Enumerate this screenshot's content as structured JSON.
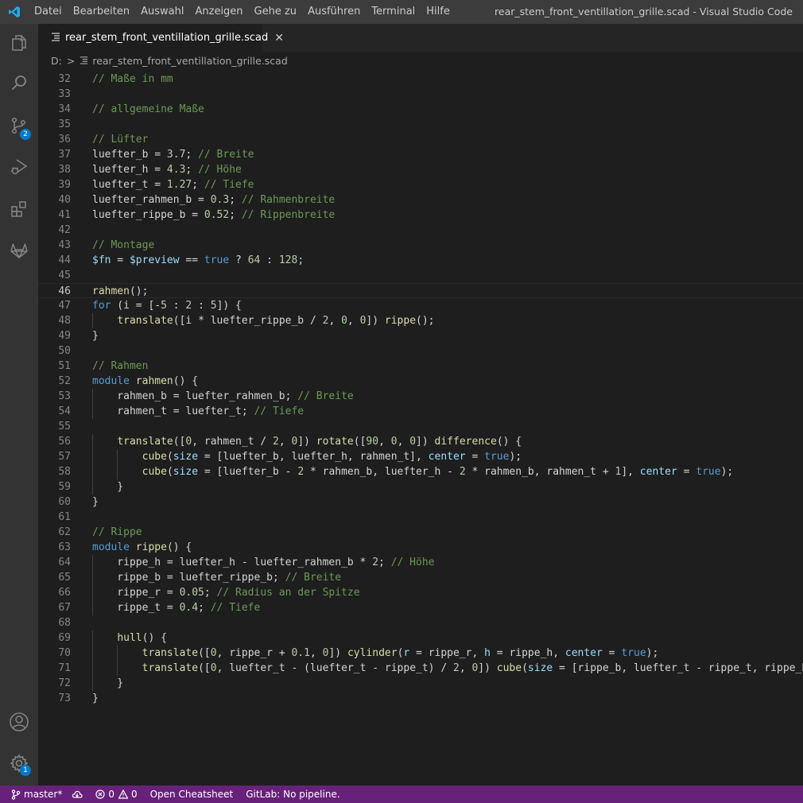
{
  "window": {
    "title": "rear_stem_front_ventillation_grille.scad - Visual Studio Code"
  },
  "menu": [
    "Datei",
    "Bearbeiten",
    "Auswahl",
    "Anzeigen",
    "Gehe zu",
    "Ausführen",
    "Terminal",
    "Hilfe"
  ],
  "activity_bar": {
    "icons": [
      "explorer-icon",
      "search-icon",
      "source-control-icon",
      "run-debug-icon",
      "extensions-icon",
      "gitlab-icon",
      "account-icon",
      "settings-gear-icon"
    ],
    "source_control_badge": "2",
    "settings_badge": "1"
  },
  "tab": {
    "label": "rear_stem_front_ventillation_grille.scad",
    "close_glyph": "✕"
  },
  "breadcrumb": {
    "drive": "D:",
    "separator": ">",
    "file": "rear_stem_front_ventillation_grille.scad"
  },
  "editor": {
    "active_line": 46,
    "lines": [
      {
        "n": "32",
        "tokens": [
          [
            "c",
            "// Maße in mm"
          ]
        ]
      },
      {
        "n": "33",
        "tokens": []
      },
      {
        "n": "34",
        "tokens": [
          [
            "c",
            "// allgemeine Maße"
          ]
        ]
      },
      {
        "n": "35",
        "tokens": []
      },
      {
        "n": "36",
        "tokens": [
          [
            "c",
            "// Lüfter"
          ]
        ]
      },
      {
        "n": "37",
        "tokens": [
          [
            "p",
            "luefter_b = "
          ],
          [
            "n",
            "3.7"
          ],
          [
            "p",
            "; "
          ],
          [
            "c",
            "// Breite"
          ]
        ]
      },
      {
        "n": "38",
        "tokens": [
          [
            "p",
            "luefter_h = "
          ],
          [
            "n",
            "4.3"
          ],
          [
            "p",
            "; "
          ],
          [
            "c",
            "// Höhe"
          ]
        ]
      },
      {
        "n": "39",
        "tokens": [
          [
            "p",
            "luefter_t = "
          ],
          [
            "n",
            "1.27"
          ],
          [
            "p",
            "; "
          ],
          [
            "c",
            "// Tiefe"
          ]
        ]
      },
      {
        "n": "40",
        "tokens": [
          [
            "p",
            "luefter_rahmen_b = "
          ],
          [
            "n",
            "0.3"
          ],
          [
            "p",
            "; "
          ],
          [
            "c",
            "// Rahmenbreite"
          ]
        ]
      },
      {
        "n": "41",
        "tokens": [
          [
            "p",
            "luefter_rippe_b = "
          ],
          [
            "n",
            "0.52"
          ],
          [
            "p",
            "; "
          ],
          [
            "c",
            "// Rippenbreite"
          ]
        ]
      },
      {
        "n": "42",
        "tokens": []
      },
      {
        "n": "43",
        "tokens": [
          [
            "c",
            "// Montage"
          ]
        ]
      },
      {
        "n": "44",
        "tokens": [
          [
            "v",
            "$fn"
          ],
          [
            "p",
            " = "
          ],
          [
            "v",
            "$preview"
          ],
          [
            "p",
            " == "
          ],
          [
            "k",
            "true"
          ],
          [
            "p",
            " ? "
          ],
          [
            "n",
            "64"
          ],
          [
            "p",
            " : "
          ],
          [
            "n",
            "128"
          ],
          [
            "p",
            ";"
          ]
        ]
      },
      {
        "n": "45",
        "tokens": []
      },
      {
        "n": "46",
        "tokens": [
          [
            "f",
            "rahmen"
          ],
          [
            "p",
            "();"
          ]
        ]
      },
      {
        "n": "47",
        "tokens": [
          [
            "k",
            "for"
          ],
          [
            "p",
            " (i = [-"
          ],
          [
            "n",
            "5"
          ],
          [
            "p",
            " : "
          ],
          [
            "n",
            "2"
          ],
          [
            "p",
            " : "
          ],
          [
            "n",
            "5"
          ],
          [
            "p",
            "]) {"
          ]
        ]
      },
      {
        "n": "48",
        "tokens": [
          [
            "p",
            "    "
          ],
          [
            "f",
            "translate"
          ],
          [
            "p",
            "([i * luefter_rippe_b / "
          ],
          [
            "n",
            "2"
          ],
          [
            "p",
            ", "
          ],
          [
            "n",
            "0"
          ],
          [
            "p",
            ", "
          ],
          [
            "n",
            "0"
          ],
          [
            "p",
            "]) "
          ],
          [
            "f",
            "rippe"
          ],
          [
            "p",
            "();"
          ]
        ]
      },
      {
        "n": "49",
        "tokens": [
          [
            "p",
            "}"
          ]
        ]
      },
      {
        "n": "50",
        "tokens": []
      },
      {
        "n": "51",
        "tokens": [
          [
            "c",
            "// Rahmen"
          ]
        ]
      },
      {
        "n": "52",
        "tokens": [
          [
            "k",
            "module"
          ],
          [
            "p",
            " "
          ],
          [
            "f",
            "rahmen"
          ],
          [
            "p",
            "() {"
          ]
        ]
      },
      {
        "n": "53",
        "tokens": [
          [
            "p",
            "    rahmen_b = luefter_rahmen_b; "
          ],
          [
            "c",
            "// Breite"
          ]
        ]
      },
      {
        "n": "54",
        "tokens": [
          [
            "p",
            "    rahmen_t = luefter_t; "
          ],
          [
            "c",
            "// Tiefe"
          ]
        ]
      },
      {
        "n": "55",
        "tokens": []
      },
      {
        "n": "56",
        "tokens": [
          [
            "p",
            "    "
          ],
          [
            "f",
            "translate"
          ],
          [
            "p",
            "(["
          ],
          [
            "n",
            "0"
          ],
          [
            "p",
            ", rahmen_t / "
          ],
          [
            "n",
            "2"
          ],
          [
            "p",
            ", "
          ],
          [
            "n",
            "0"
          ],
          [
            "p",
            "]) "
          ],
          [
            "f",
            "rotate"
          ],
          [
            "p",
            "(["
          ],
          [
            "n",
            "90"
          ],
          [
            "p",
            ", "
          ],
          [
            "n",
            "0"
          ],
          [
            "p",
            ", "
          ],
          [
            "n",
            "0"
          ],
          [
            "p",
            "]) "
          ],
          [
            "f",
            "difference"
          ],
          [
            "p",
            "() {"
          ]
        ]
      },
      {
        "n": "57",
        "tokens": [
          [
            "p",
            "        "
          ],
          [
            "f",
            "cube"
          ],
          [
            "p",
            "("
          ],
          [
            "v",
            "size"
          ],
          [
            "p",
            " = [luefter_b, luefter_h, rahmen_t], "
          ],
          [
            "v",
            "center"
          ],
          [
            "p",
            " = "
          ],
          [
            "k",
            "true"
          ],
          [
            "p",
            ");"
          ]
        ]
      },
      {
        "n": "58",
        "tokens": [
          [
            "p",
            "        "
          ],
          [
            "f",
            "cube"
          ],
          [
            "p",
            "("
          ],
          [
            "v",
            "size"
          ],
          [
            "p",
            " = [luefter_b - "
          ],
          [
            "n",
            "2"
          ],
          [
            "p",
            " * rahmen_b, luefter_h - "
          ],
          [
            "n",
            "2"
          ],
          [
            "p",
            " * rahmen_b, rahmen_t + "
          ],
          [
            "n",
            "1"
          ],
          [
            "p",
            "], "
          ],
          [
            "v",
            "center"
          ],
          [
            "p",
            " = "
          ],
          [
            "k",
            "true"
          ],
          [
            "p",
            ");"
          ]
        ]
      },
      {
        "n": "59",
        "tokens": [
          [
            "p",
            "    }"
          ]
        ]
      },
      {
        "n": "60",
        "tokens": [
          [
            "p",
            "}"
          ]
        ]
      },
      {
        "n": "61",
        "tokens": []
      },
      {
        "n": "62",
        "tokens": [
          [
            "c",
            "// Rippe"
          ]
        ]
      },
      {
        "n": "63",
        "tokens": [
          [
            "k",
            "module"
          ],
          [
            "p",
            " "
          ],
          [
            "f",
            "rippe"
          ],
          [
            "p",
            "() {"
          ]
        ]
      },
      {
        "n": "64",
        "tokens": [
          [
            "p",
            "    rippe_h = luefter_h - luefter_rahmen_b * "
          ],
          [
            "n",
            "2"
          ],
          [
            "p",
            "; "
          ],
          [
            "c",
            "// Höhe"
          ]
        ]
      },
      {
        "n": "65",
        "tokens": [
          [
            "p",
            "    rippe_b = luefter_rippe_b; "
          ],
          [
            "c",
            "// Breite"
          ]
        ]
      },
      {
        "n": "66",
        "tokens": [
          [
            "p",
            "    rippe_r = "
          ],
          [
            "n",
            "0.05"
          ],
          [
            "p",
            "; "
          ],
          [
            "c",
            "// Radius an der Spitze"
          ]
        ]
      },
      {
        "n": "67",
        "tokens": [
          [
            "p",
            "    rippe_t = "
          ],
          [
            "n",
            "0.4"
          ],
          [
            "p",
            "; "
          ],
          [
            "c",
            "// Tiefe"
          ]
        ]
      },
      {
        "n": "68",
        "tokens": []
      },
      {
        "n": "69",
        "tokens": [
          [
            "p",
            "    "
          ],
          [
            "f",
            "hull"
          ],
          [
            "p",
            "() {"
          ]
        ]
      },
      {
        "n": "70",
        "tokens": [
          [
            "p",
            "        "
          ],
          [
            "f",
            "translate"
          ],
          [
            "p",
            "(["
          ],
          [
            "n",
            "0"
          ],
          [
            "p",
            ", rippe_r + "
          ],
          [
            "n",
            "0.1"
          ],
          [
            "p",
            ", "
          ],
          [
            "n",
            "0"
          ],
          [
            "p",
            "]) "
          ],
          [
            "f",
            "cylinder"
          ],
          [
            "p",
            "("
          ],
          [
            "v",
            "r"
          ],
          [
            "p",
            " = rippe_r, "
          ],
          [
            "v",
            "h"
          ],
          [
            "p",
            " = rippe_h, "
          ],
          [
            "v",
            "center"
          ],
          [
            "p",
            " = "
          ],
          [
            "k",
            "true"
          ],
          [
            "p",
            ");"
          ]
        ]
      },
      {
        "n": "71",
        "tokens": [
          [
            "p",
            "        "
          ],
          [
            "f",
            "translate"
          ],
          [
            "p",
            "(["
          ],
          [
            "n",
            "0"
          ],
          [
            "p",
            ", luefter_t - (luefter_t - rippe_t) / "
          ],
          [
            "n",
            "2"
          ],
          [
            "p",
            ", "
          ],
          [
            "n",
            "0"
          ],
          [
            "p",
            "]) "
          ],
          [
            "f",
            "cube"
          ],
          [
            "p",
            "("
          ],
          [
            "v",
            "size"
          ],
          [
            "p",
            " = [rippe_b, luefter_t - rippe_t, rippe_h]"
          ]
        ]
      },
      {
        "n": "72",
        "tokens": [
          [
            "p",
            "    }"
          ]
        ]
      },
      {
        "n": "73",
        "tokens": [
          [
            "p",
            "}"
          ]
        ]
      }
    ]
  },
  "statusbar": {
    "branch": "master*",
    "errors": "0",
    "warnings": "0",
    "cheatsheet": "Open Cheatsheet",
    "gitlab": "GitLab: No pipeline."
  }
}
